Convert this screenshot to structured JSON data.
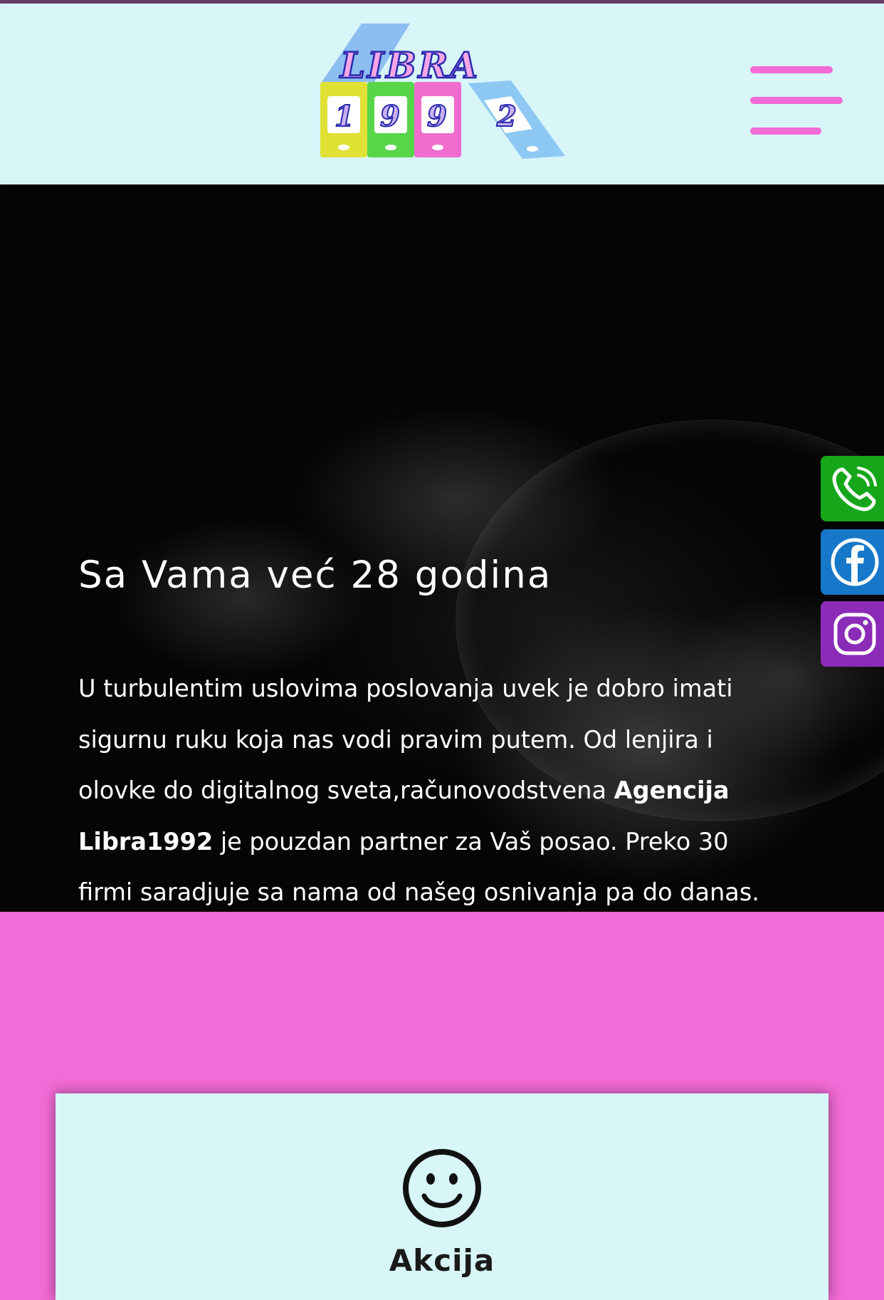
{
  "header": {
    "logo": {
      "text_top": "LIBRA",
      "digits": [
        "1",
        "9",
        "9",
        "2"
      ]
    },
    "menu_icon": "hamburger-icon"
  },
  "hero": {
    "title": "Sa Vama već 28 godina",
    "paragraph": {
      "part1": "U turbulentim uslovima poslovanja uvek je dobro imati sigurnu ruku koja nas vodi pravim putem. Od lenjira i olovke do digitalnog sveta,računovodstvena ",
      "bold": "Agencija Libra1992",
      "part2": " je pouzdan partner za Vaš posao. Preko 30 firmi saradjuje sa nama od našeg osnivanja pa do danas."
    }
  },
  "side_buttons": [
    {
      "icon": "phone-icon",
      "color": "#16a61a"
    },
    {
      "icon": "facebook-icon",
      "color": "#1778c9"
    },
    {
      "icon": "instagram-icon",
      "color": "#8b2cb8"
    }
  ],
  "card": {
    "icon": "smiley-icon",
    "title": "Akcija"
  },
  "colors": {
    "header_bg": "#d8f5f8",
    "accent_pink": "#f26bd6",
    "hero_bg": "#050505",
    "top_line": "#6b3f6b"
  }
}
